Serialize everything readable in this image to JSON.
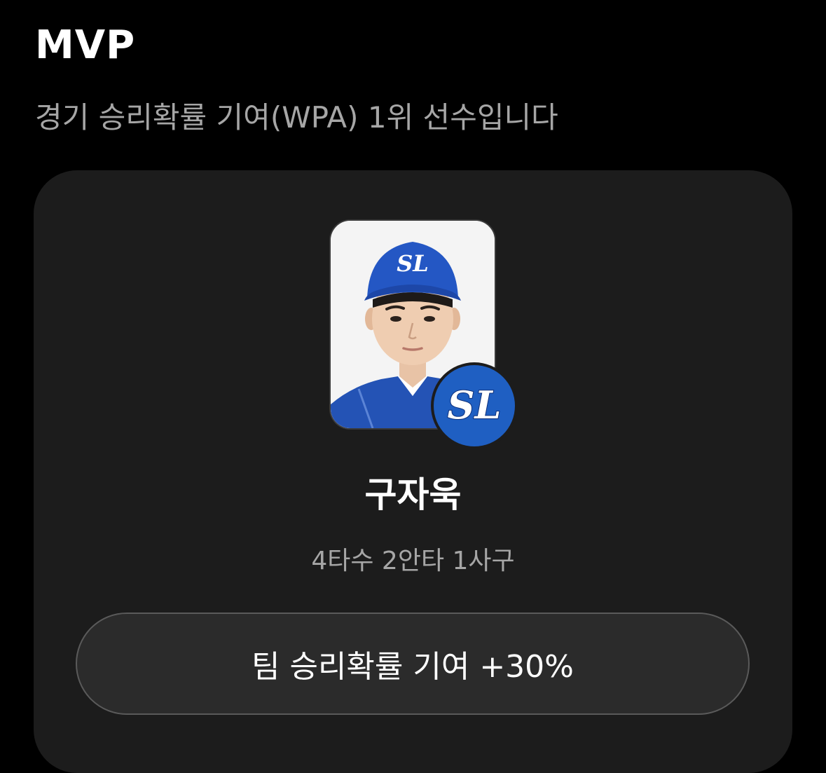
{
  "header": {
    "title": "MVP",
    "subtitle": "경기 승리확률 기여(WPA) 1위 선수입니다"
  },
  "mvp_card": {
    "player_name": "구자욱",
    "stats": "4타수 2안타 1사구",
    "wpa_label": "팀 승리확률 기여 +30%",
    "team_logo_text": "SL",
    "photo_icon": "player-photo",
    "colors": {
      "team_blue": "#1f5fc2",
      "card_bg": "#1c1c1c",
      "button_bg": "#2b2b2b"
    }
  }
}
